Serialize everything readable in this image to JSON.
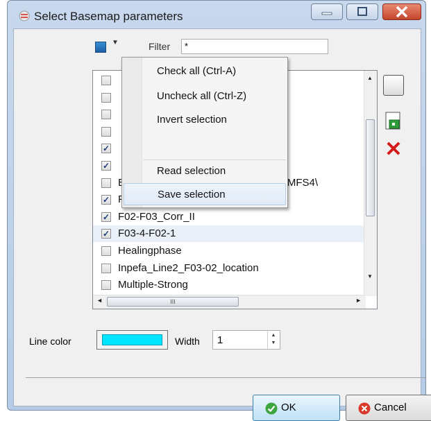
{
  "window": {
    "title": "Select Basemap parameters"
  },
  "toolbar": {
    "filter_label": "Filter",
    "filter_value": "*"
  },
  "list": {
    "items": [
      {
        "label": "",
        "checked": false
      },
      {
        "label": "",
        "checked": false
      },
      {
        "label": "",
        "checked": false
      },
      {
        "label": "",
        "checked": false
      },
      {
        "label": "",
        "checked": true
      },
      {
        "label": "",
        "checked": true
      },
      {
        "label": "Example random contour demo 1 -> MFS4\\",
        "checked": false
      },
      {
        "label": "F02-F03_Corr",
        "checked": true
      },
      {
        "label": "F02-F03_Corr_II",
        "checked": true
      },
      {
        "label": "F03-4-F02-1",
        "checked": true
      },
      {
        "label": "Healingphase",
        "checked": false
      },
      {
        "label": "Inpefa_Line2_F03-02_location",
        "checked": false
      },
      {
        "label": "Multiple-Strong",
        "checked": false
      }
    ],
    "hscroll_thumb": "III"
  },
  "context_menu": {
    "items": [
      {
        "label": "Check all (Ctrl-A)"
      },
      {
        "label": "Uncheck all (Ctrl-Z)"
      },
      {
        "label": "Invert selection"
      },
      {
        "label": "Read selection"
      },
      {
        "label": "Save selection"
      }
    ]
  },
  "line_color": {
    "label": "Line color",
    "color": "#00e5ff"
  },
  "width": {
    "label": "Width",
    "value": "1"
  },
  "buttons": {
    "ok": "OK",
    "cancel": "Cancel"
  }
}
